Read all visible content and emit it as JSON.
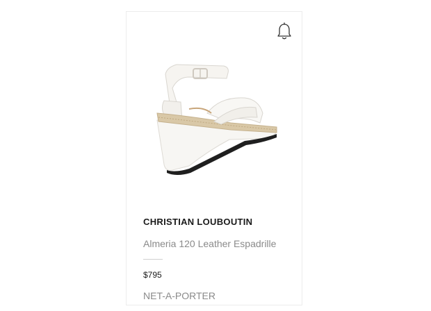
{
  "product": {
    "brand": "CHRISTIAN LOUBOUTIN",
    "name": "Almeria 120 Leather Espadrille",
    "price": "$795",
    "retailer": "NET-A-PORTER",
    "image_icon": "wedge-sandal-image",
    "alert_icon": "bell-icon"
  },
  "colors": {
    "card_border": "#ececec",
    "brand_text": "#1a1a1a",
    "secondary_text": "#8a8a8a",
    "shoe_leather": "#f4f2ee",
    "espadrille": "#d8c7a6"
  }
}
